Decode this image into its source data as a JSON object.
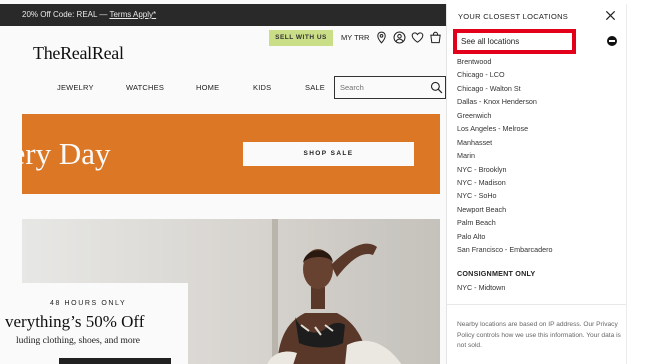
{
  "promo": {
    "text": "20% Off Code: REAL — ",
    "link": "Terms Apply*"
  },
  "header": {
    "logo": "TheRealReal",
    "sell_button": "SELL WITH US",
    "my_trr": "MY TRR",
    "icons": [
      "location-pin-icon",
      "account-icon",
      "heart-icon",
      "bag-icon"
    ]
  },
  "nav": {
    "items": [
      "JEWELRY",
      "WATCHES",
      "HOME",
      "KIDS",
      "SALE"
    ]
  },
  "search": {
    "placeholder": "Search"
  },
  "hero": {
    "title": "very Day",
    "cta": "SHOP SALE",
    "color": "#e07a26"
  },
  "promo_card": {
    "kicker": "48 HOURS ONLY",
    "title": "verything’s 50% Off",
    "subtitle": "luding clothing, shoes, and more"
  },
  "panel": {
    "title": "YOUR CLOSEST LOCATIONS",
    "see_all": "See all locations",
    "highlight_color": "#e3001b",
    "locations": [
      "Brentwood",
      "Chicago - LCO",
      "Chicago - Walton St",
      "Dallas - Knox Henderson",
      "Greenwich",
      "Los Angeles - Melrose",
      "Manhasset",
      "Marin",
      "NYC - Brooklyn",
      "NYC - Madison",
      "NYC - SoHo",
      "Newport Beach",
      "Palm Beach",
      "Palo Alto",
      "San Francisco - Embarcadero"
    ],
    "consignment_heading": "CONSIGNMENT ONLY",
    "consignment_locations": [
      "NYC - Midtown"
    ],
    "note": "Nearby locations are based on IP address. Our Privacy Policy controls how we use this information. Your data is not sold."
  }
}
